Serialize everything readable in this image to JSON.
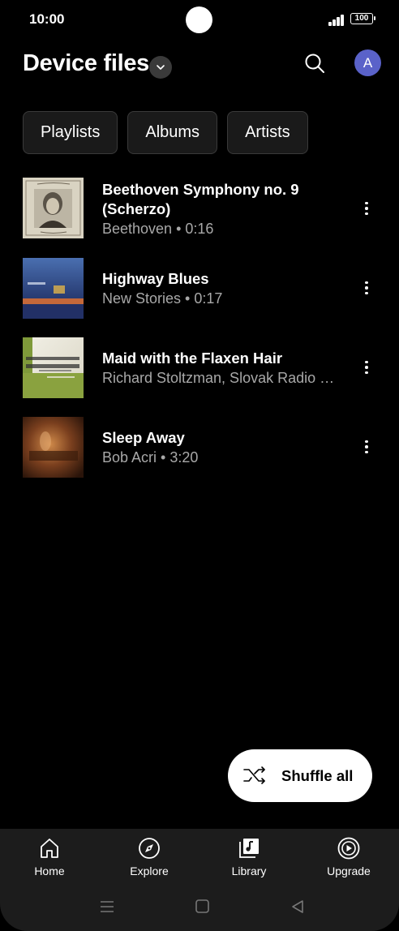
{
  "status_bar": {
    "time": "10:00",
    "battery": "100"
  },
  "header": {
    "title": "Device files",
    "avatar_letter": "A"
  },
  "chips": [
    "Playlists",
    "Albums",
    "Artists"
  ],
  "songs": [
    {
      "title": "Beethoven Symphony no. 9 (Scherzo)",
      "subtitle": "Beethoven • 0:16"
    },
    {
      "title": "Highway Blues",
      "subtitle": "New Stories • 0:17"
    },
    {
      "title": "Maid with the Flaxen Hair",
      "subtitle": "Richard Stoltzman, Slovak Radio …"
    },
    {
      "title": "Sleep Away",
      "subtitle": "Bob Acri • 3:20"
    }
  ],
  "shuffle": {
    "label": "Shuffle all"
  },
  "nav": {
    "items": [
      {
        "label": "Home",
        "icon": "home-icon"
      },
      {
        "label": "Explore",
        "icon": "compass-icon"
      },
      {
        "label": "Library",
        "icon": "library-icon"
      },
      {
        "label": "Upgrade",
        "icon": "upgrade-icon"
      }
    ]
  },
  "colors": {
    "avatar": "#5a62c9",
    "background": "#000000",
    "nav_background": "#1c1c1c"
  }
}
